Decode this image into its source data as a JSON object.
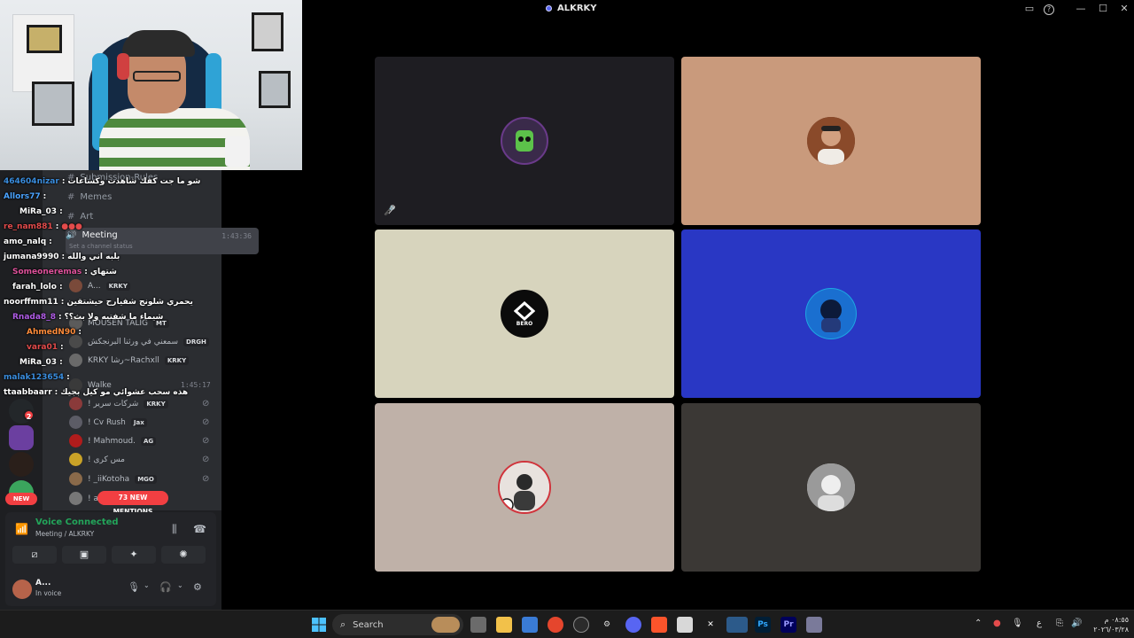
{
  "window": {
    "title": "ALKRKY",
    "controls": {
      "cast": "▭",
      "help": "?",
      "minimize": "—",
      "maximize": "☐",
      "close": "✕"
    }
  },
  "chat": [
    {
      "name": "464604nizar",
      "msg": "شو ما جت كفك شاهدت وكساعات",
      "color": "#3a8dde"
    },
    {
      "name": "Allors77",
      "msg": "",
      "color": "#4aa3ff"
    },
    {
      "name": "MiRa_03",
      "msg": "",
      "color": "#ffffff"
    },
    {
      "name": "re_nam881",
      "msg": "",
      "color": "#e34b4b"
    },
    {
      "name": "amo_nalq",
      "msg": "",
      "color": "#ffffff"
    },
    {
      "name": "jumana9990",
      "msg": "بلبه اني والله",
      "color": "#ffffff"
    },
    {
      "name": "Someoneremas",
      "msg": "شتهاي",
      "color": "#e0529c"
    },
    {
      "name": "farah_lolo",
      "msg": "",
      "color": "#ffffff"
    },
    {
      "name": "noorffmm11",
      "msg": "يحمري شلونج شفيارح حيشتقين",
      "color": "#ffffff"
    },
    {
      "name": "Rnada8_8",
      "msg": "شيماء ما شفتيه ولا بث؟؟",
      "color": "#b05ce6"
    },
    {
      "name": "AhmedN90",
      "msg": "",
      "color": "#ff8c3a"
    },
    {
      "name": "vara01",
      "msg": "",
      "color": "#e34b4b"
    },
    {
      "name": "MiRa_03",
      "msg": "",
      "color": "#ffffff"
    },
    {
      "name": "malak123654",
      "msg": "",
      "color": "#3a8dde"
    },
    {
      "name": "ttaabbaarr",
      "msg": "هذه سحب عشوائي مو كيل بجيك",
      "color": "#ffffff"
    }
  ],
  "channels": [
    {
      "label": "Submission-Rules",
      "active": false
    },
    {
      "label": "Memes",
      "active": false
    },
    {
      "label": "Art",
      "active": false
    },
    {
      "label": "Meeting",
      "active": true,
      "time": "1:43:36",
      "status": "Set a channel status"
    }
  ],
  "voice_users": [
    {
      "name": "A...",
      "tag": "KRKY",
      "av": "#7a4a3a"
    },
    {
      "name": "MOUSEN TALIG",
      "tag": "MT",
      "av": "#5b5b5b"
    },
    {
      "name": "سمعني في ورثنا البرنجكش",
      "tag": "DRGH",
      "av": "#4a4a4a"
    },
    {
      "name": "KRKY رشا~Rachxll",
      "tag": "KRKY",
      "av": "#6a6a6a"
    },
    {
      "name": "Walke",
      "tag": "",
      "time": "1:45:17",
      "av": "#3a3a3a"
    },
    {
      "name": "! شركات سرير",
      "tag": "KRKY",
      "av": "#8a3a3a"
    },
    {
      "name": "! Cv Rush",
      "tag": "Jax",
      "av": "#5c5c66"
    },
    {
      "name": "! Mahmoud.",
      "tag": "AG",
      "av": "#b01c1c"
    },
    {
      "name": "! مس كرى",
      "tag": "",
      "av": "#c9a227"
    },
    {
      "name": "! _iiKotoha",
      "tag": "MGO",
      "av": "#8a6a4a"
    },
    {
      "name": "! a",
      "tag": "",
      "av": "#777777"
    }
  ],
  "mentions": "73 NEW MENTIONS",
  "new_label": "NEW",
  "server_badge": "2",
  "voice_panel": {
    "status": "Voice Connected",
    "channel": "Meeting / ALKRKY"
  },
  "user_panel": {
    "name": "A...",
    "status": "In voice"
  },
  "tiles": [
    {
      "bg": "#1e1d22",
      "avatar_bg": "#3a2a4a",
      "muted": true
    },
    {
      "bg": "#c99a7c",
      "avatar_bg": "#6b3e2c",
      "muted": false
    },
    {
      "bg": "#d7d4bd",
      "avatar_bg": "#0b0b0b",
      "label": "BERO",
      "muted": false
    },
    {
      "bg": "#2937c4",
      "avatar_bg": "#1ea7e3",
      "muted": false
    },
    {
      "bg": "#bfb1a8",
      "avatar_bg": "#f3f0ee",
      "muted": false
    },
    {
      "bg": "#3b3835",
      "avatar_bg": "#cfcfcf",
      "muted": false
    }
  ],
  "taskbar": {
    "search_label": "Search",
    "time": "٠٨:٥٥ م",
    "date": "٢٠٢٦/٠٣/٢٨",
    "lang": "ع"
  },
  "colors": {
    "accent": "#5865f2",
    "voice_green": "#23a55a",
    "mention_red": "#f23f42"
  }
}
